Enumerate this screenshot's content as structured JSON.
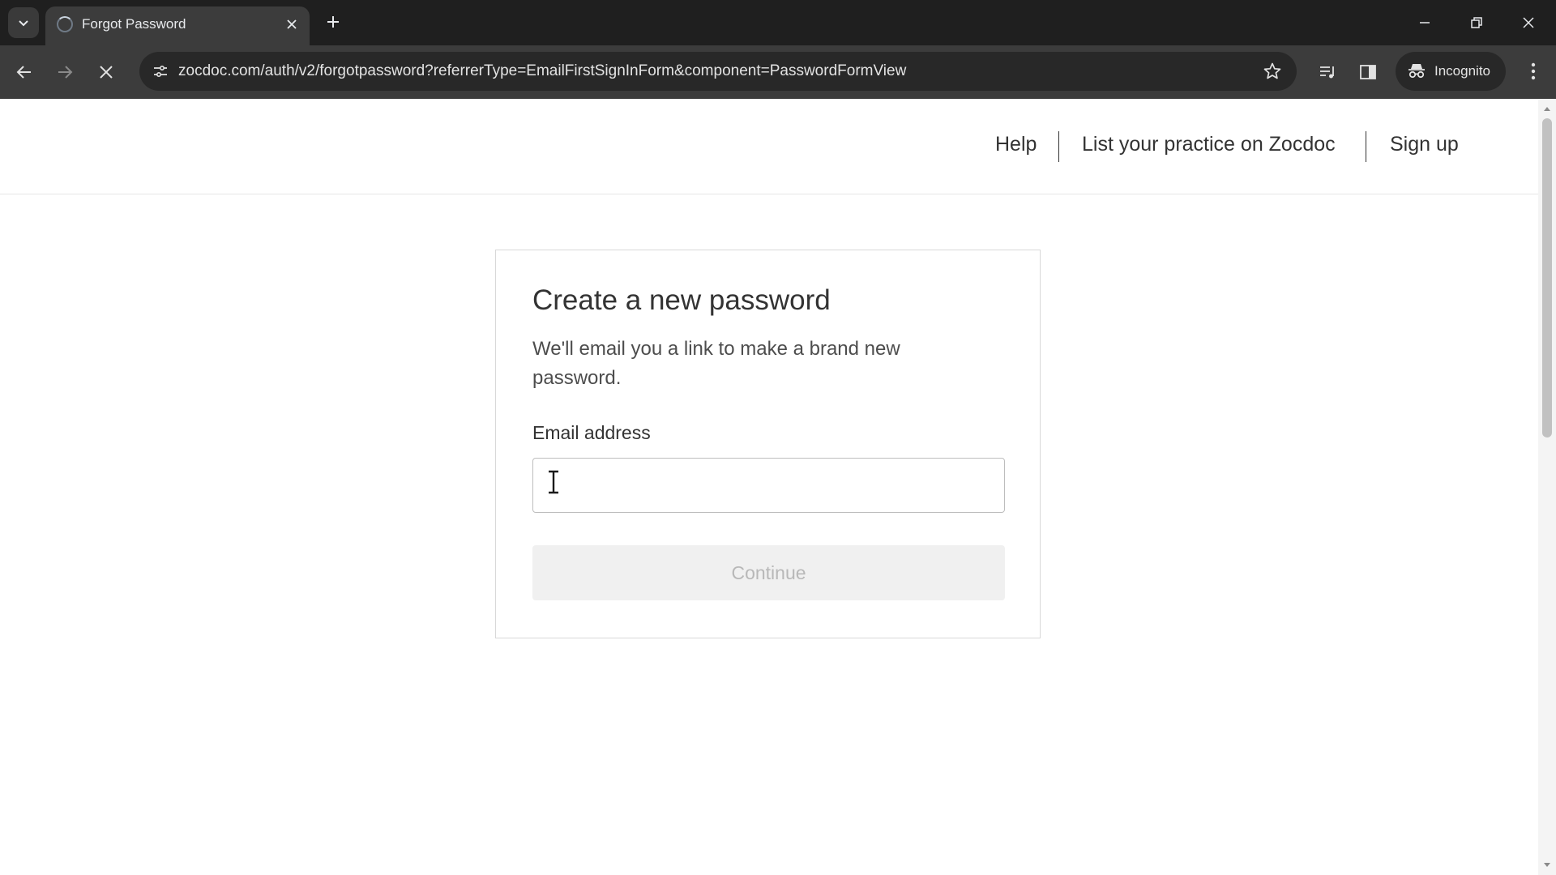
{
  "browser": {
    "tab_title": "Forgot Password",
    "url": "zocdoc.com/auth/v2/forgotpassword?referrerType=EmailFirstSignInForm&component=PasswordFormView",
    "incognito_label": "Incognito",
    "icons": [
      "chevron-down-icon",
      "loading-spinner-icon",
      "close-icon",
      "plus-icon",
      "minimize-icon",
      "restore-icon",
      "close-window-icon",
      "back-arrow-icon",
      "forward-arrow-icon",
      "stop-loading-icon",
      "site-settings-icon",
      "star-icon",
      "media-queue-icon",
      "side-panel-icon",
      "incognito-icon",
      "more-vert-icon"
    ]
  },
  "header": {
    "links": [
      "Help",
      "List your practice on Zocdoc",
      "Sign up"
    ]
  },
  "form": {
    "title": "Create a new password",
    "subtitle": "We'll email you a link to make a brand new password.",
    "email_label": "Email address",
    "email_value": "",
    "email_placeholder": "",
    "continue_label": "Continue"
  },
  "colors": {
    "chrome_dark": "#1f1f1f",
    "chrome_toolbar": "#3c3c3c",
    "text_primary": "#333333",
    "button_disabled_bg": "#f0f0f0",
    "button_disabled_text": "#b8b8b8"
  }
}
